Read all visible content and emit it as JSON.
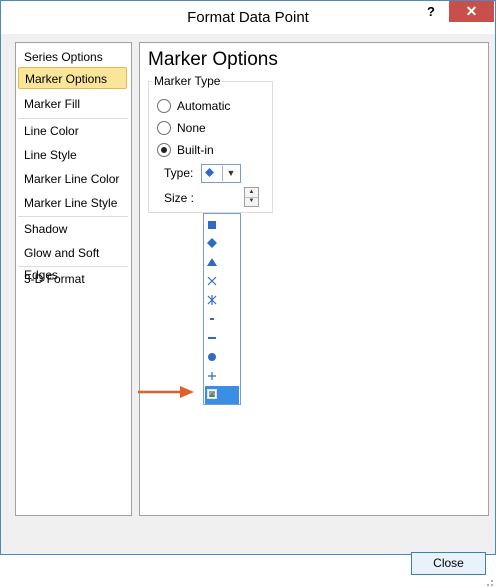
{
  "window": {
    "title": "Format Data Point",
    "help_glyph": "?",
    "close_glyph": "✕"
  },
  "nav": {
    "items": [
      {
        "label": "Series Options",
        "selected": false
      },
      {
        "label": "Marker Options",
        "selected": true
      },
      {
        "label": "Marker Fill",
        "selected": false
      },
      {
        "label": "Line Color",
        "selected": false
      },
      {
        "label": "Line Style",
        "selected": false
      },
      {
        "label": "Marker Line Color",
        "selected": false
      },
      {
        "label": "Marker Line Style",
        "selected": false
      },
      {
        "label": "Shadow",
        "selected": false
      },
      {
        "label": "Glow and Soft Edges",
        "selected": false
      },
      {
        "label": "3-D Format",
        "selected": false
      }
    ]
  },
  "panel": {
    "title": "Marker Options",
    "marker_type": {
      "group_label": "Marker Type",
      "options": [
        {
          "label": "Automatic",
          "checked": false
        },
        {
          "label": "None",
          "checked": false
        },
        {
          "label": "Built-in",
          "checked": true
        }
      ],
      "type_label": "Type:",
      "type_selected_icon": "diamond-marker",
      "size_label": "Size :"
    }
  },
  "dropdown": {
    "items": [
      {
        "icon": "square-marker",
        "highlighted": false
      },
      {
        "icon": "diamond-marker",
        "highlighted": false
      },
      {
        "icon": "triangle-marker",
        "highlighted": false
      },
      {
        "icon": "x-marker",
        "highlighted": false
      },
      {
        "icon": "star-marker",
        "highlighted": false
      },
      {
        "icon": "short-dash-marker",
        "highlighted": false
      },
      {
        "icon": "long-dash-marker",
        "highlighted": false
      },
      {
        "icon": "circle-marker",
        "highlighted": false
      },
      {
        "icon": "plus-marker",
        "highlighted": false
      },
      {
        "icon": "picture-marker",
        "highlighted": true
      }
    ]
  },
  "annotation": {
    "icon": "pointer-arrow",
    "color": "#e0602a"
  },
  "footer": {
    "close_label": "Close"
  },
  "colors": {
    "accent": "#3b8ee5",
    "marker": "#2e6cc4",
    "selected_nav": "#fbe59a",
    "titlebar_close": "#c7514a"
  }
}
